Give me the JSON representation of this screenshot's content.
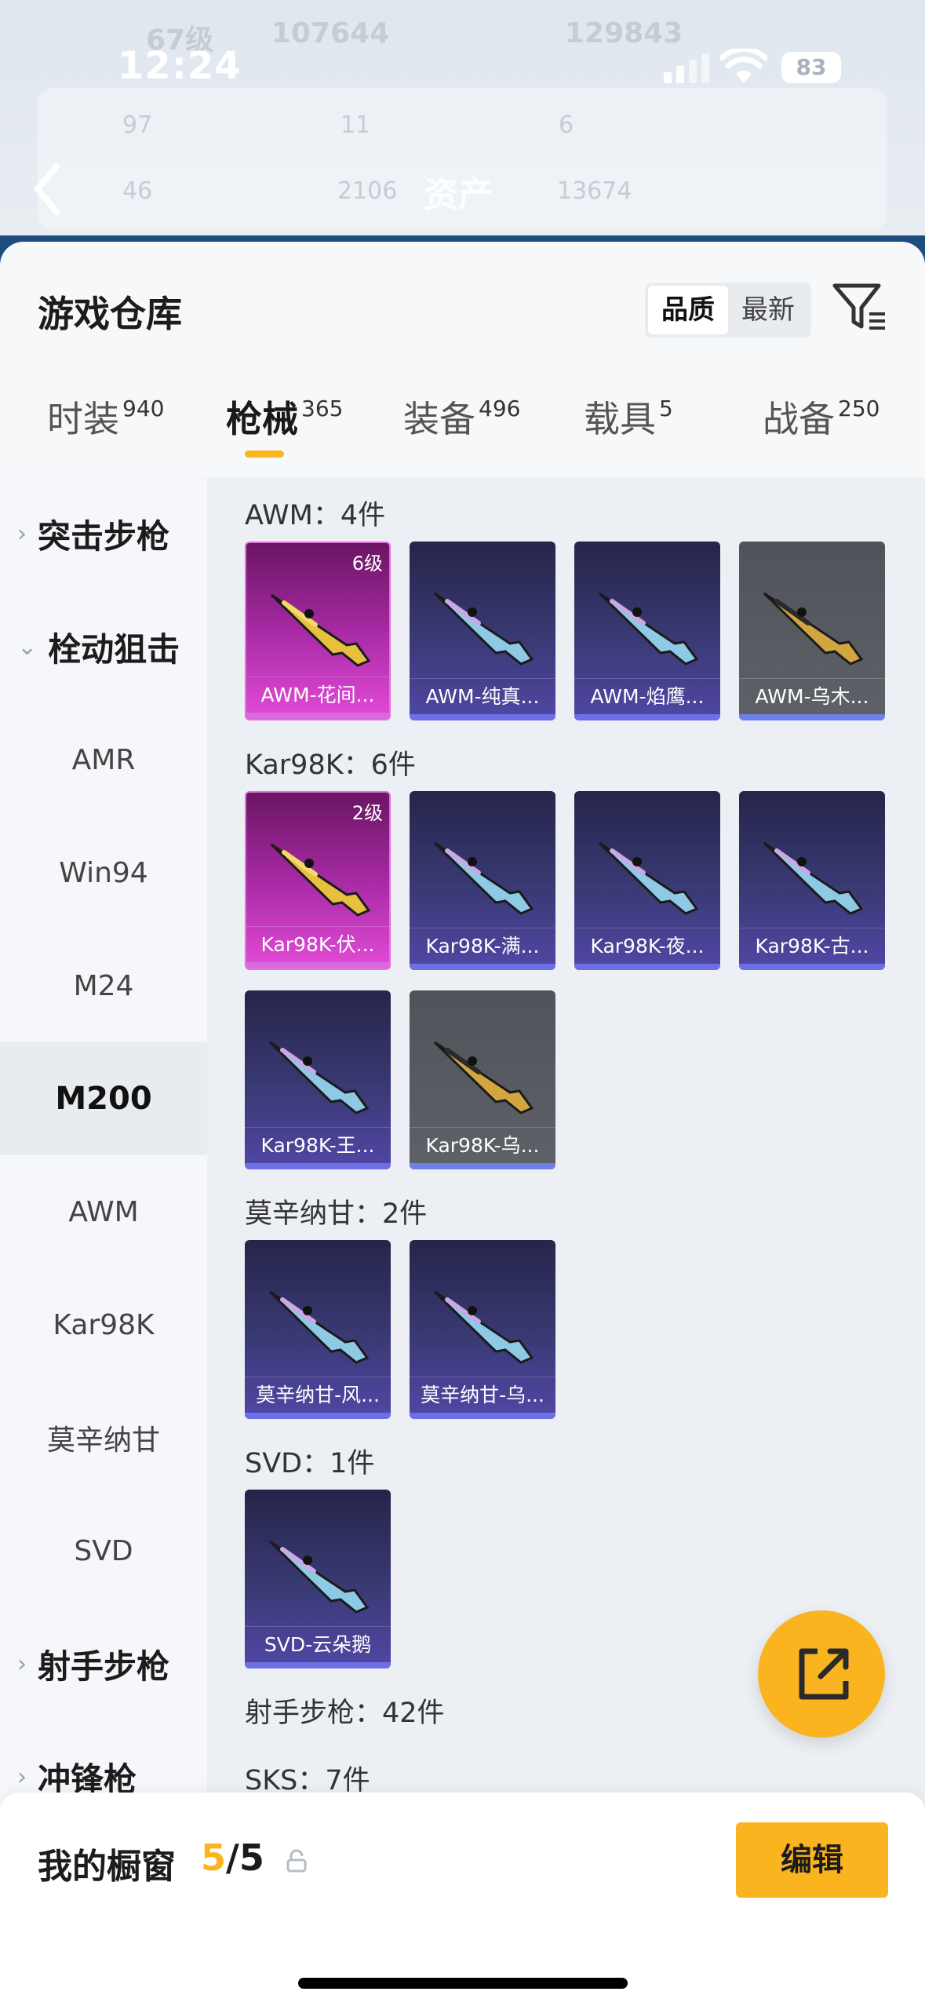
{
  "status": {
    "time": "12:24",
    "battery": "83"
  },
  "background_header": {
    "level": "67级",
    "id_text": "107644",
    "score": "129843",
    "stats_row1": [
      "97",
      "11",
      "6"
    ],
    "stats_row2": [
      "46",
      "2106",
      "13674"
    ],
    "title": "资产"
  },
  "sheet": {
    "title": "游戏仓库",
    "sort": {
      "options": [
        "品质",
        "最新"
      ],
      "selected": "品质"
    }
  },
  "tabs": [
    {
      "label": "时装",
      "count": "940"
    },
    {
      "label": "枪械",
      "count": "365"
    },
    {
      "label": "装备",
      "count": "496"
    },
    {
      "label": "载具",
      "count": "5"
    },
    {
      "label": "战备",
      "count": "250"
    }
  ],
  "active_tab": "枪械",
  "sidebar": [
    {
      "label": "突击步枪",
      "type": "group",
      "expanded": false
    },
    {
      "label": "栓动狙击",
      "type": "group",
      "expanded": true
    },
    {
      "label": "AMR",
      "type": "sub"
    },
    {
      "label": "Win94",
      "type": "sub"
    },
    {
      "label": "M24",
      "type": "sub"
    },
    {
      "label": "M200",
      "type": "sub",
      "selected": true
    },
    {
      "label": "AWM",
      "type": "sub"
    },
    {
      "label": "Kar98K",
      "type": "sub"
    },
    {
      "label": "莫辛纳甘",
      "type": "sub"
    },
    {
      "label": "SVD",
      "type": "sub"
    },
    {
      "label": "射手步枪",
      "type": "group",
      "expanded": false
    },
    {
      "label": "冲锋枪",
      "type": "group",
      "expanded": false
    }
  ],
  "groups": [
    {
      "title": "AWM：4件",
      "items": [
        {
          "name": "AWM-花间...",
          "rarity": "pink",
          "level": "6级"
        },
        {
          "name": "AWM-纯真...",
          "rarity": "purple"
        },
        {
          "name": "AWM-焰鹰...",
          "rarity": "purple"
        },
        {
          "name": "AWM-乌木...",
          "rarity": "gray"
        }
      ]
    },
    {
      "title": "Kar98K：6件",
      "items": [
        {
          "name": "Kar98K-伏...",
          "rarity": "pink",
          "level": "2级"
        },
        {
          "name": "Kar98K-满...",
          "rarity": "purple"
        },
        {
          "name": "Kar98K-夜...",
          "rarity": "purple"
        },
        {
          "name": "Kar98K-古...",
          "rarity": "purple"
        },
        {
          "name": "Kar98K-王...",
          "rarity": "purple"
        },
        {
          "name": "Kar98K-乌...",
          "rarity": "gray"
        }
      ]
    },
    {
      "title": "莫辛纳甘：2件",
      "items": [
        {
          "name": "莫辛纳甘-风...",
          "rarity": "purple"
        },
        {
          "name": "莫辛纳甘-乌...",
          "rarity": "purple"
        }
      ]
    },
    {
      "title": "SVD：1件",
      "items": [
        {
          "name": "SVD-云朵鹅",
          "rarity": "purple"
        }
      ]
    },
    {
      "title": "射手步枪：42件",
      "items": []
    },
    {
      "title": "SKS：7件",
      "items": []
    }
  ],
  "showcase": {
    "label": "我的橱窗",
    "used": "5",
    "total": "/5",
    "edit_label": "编辑"
  },
  "colors": {
    "accent": "#f9b41f",
    "pink_rarity": "#e24bd8",
    "purple_rarity": "#5147a6",
    "gray_rarity": "#5e6168"
  },
  "icons": {
    "back": "chevron-left-icon",
    "filter": "filter-icon",
    "share": "share-icon",
    "lock": "lock-icon"
  }
}
